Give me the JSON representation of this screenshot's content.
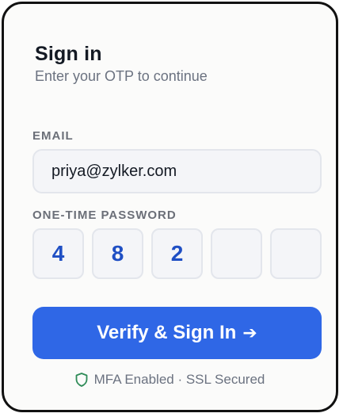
{
  "header": {
    "title": "Sign in",
    "subtitle": "Enter your OTP to continue"
  },
  "email": {
    "label": "EMAIL",
    "value": "priya@zylker.com"
  },
  "otp": {
    "label": "ONE-TIME PASSWORD",
    "digits": [
      "4",
      "8",
      "2",
      "",
      ""
    ]
  },
  "submit": {
    "label": "Verify & Sign In",
    "arrow": "➔"
  },
  "footer": {
    "icon": "shield-icon",
    "text": "MFA Enabled · SSL Secured"
  },
  "colors": {
    "accent": "#2f67e6",
    "otp_digit": "#1f4fc4",
    "shield": "#2e8b57"
  }
}
